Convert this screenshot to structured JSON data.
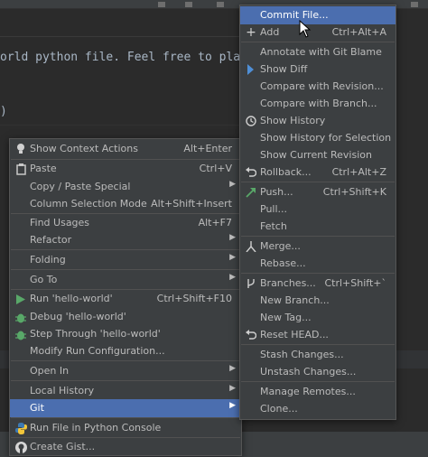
{
  "colors": {
    "menu_bg": "#3c3f41",
    "selected": "#4b6eaf",
    "editor_bg": "#2b2b2b",
    "green_icon": "#59a869"
  },
  "editor": {
    "code_line": "orld python file. Feel free to play a",
    "paren": ")"
  },
  "context_menu": {
    "items": [
      {
        "label": "Show Context Actions",
        "shortcut": "Alt+Enter",
        "icon": "lightbulb-icon"
      },
      {
        "label": "Paste",
        "shortcut": "Ctrl+V",
        "icon": "clipboard-icon"
      },
      {
        "label": "Copy / Paste Special",
        "submenu": true
      },
      {
        "label": "Column Selection Mode",
        "shortcut": "Alt+Shift+Insert"
      },
      {
        "label": "Find Usages",
        "shortcut": "Alt+F7"
      },
      {
        "label": "Refactor",
        "submenu": true
      },
      {
        "label": "Folding",
        "submenu": true
      },
      {
        "label": "Go To",
        "submenu": true
      },
      {
        "label": "Run 'hello-world'",
        "shortcut": "Ctrl+Shift+F10",
        "icon": "run-icon"
      },
      {
        "label": "Debug 'hello-world'",
        "icon": "debug-icon"
      },
      {
        "label": "Step Through 'hello-world'",
        "icon": "step-debug-icon"
      },
      {
        "label": "Modify Run Configuration..."
      },
      {
        "label": "Open In",
        "submenu": true
      },
      {
        "label": "Local History",
        "submenu": true
      },
      {
        "label": "Git",
        "submenu": true,
        "selected": true
      },
      {
        "label": "Run File in Python Console",
        "icon": "python-icon"
      },
      {
        "label": "Create Gist...",
        "icon": "github-icon"
      }
    ]
  },
  "git_menu": {
    "items": [
      {
        "label": "Commit File...",
        "selected": true
      },
      {
        "label": "Add",
        "shortcut": "Ctrl+Alt+A",
        "icon": "plus-icon"
      },
      {
        "label": "Annotate with Git Blame"
      },
      {
        "label": "Show Diff",
        "icon": "diff-icon"
      },
      {
        "label": "Compare with Revision..."
      },
      {
        "label": "Compare with Branch..."
      },
      {
        "label": "Show History",
        "icon": "history-icon"
      },
      {
        "label": "Show History for Selection"
      },
      {
        "label": "Show Current Revision"
      },
      {
        "label": "Rollback...",
        "shortcut": "Ctrl+Alt+Z",
        "icon": "rollback-icon"
      },
      {
        "label": "Push...",
        "shortcut": "Ctrl+Shift+K",
        "icon": "push-icon"
      },
      {
        "label": "Pull..."
      },
      {
        "label": "Fetch"
      },
      {
        "label": "Merge...",
        "icon": "merge-icon"
      },
      {
        "label": "Rebase..."
      },
      {
        "label": "Branches...",
        "shortcut": "Ctrl+Shift+`",
        "icon": "branch-icon"
      },
      {
        "label": "New Branch..."
      },
      {
        "label": "New Tag..."
      },
      {
        "label": "Reset HEAD...",
        "icon": "reset-icon"
      },
      {
        "label": "Stash Changes..."
      },
      {
        "label": "Unstash Changes..."
      },
      {
        "label": "Manage Remotes..."
      },
      {
        "label": "Clone..."
      }
    ]
  }
}
